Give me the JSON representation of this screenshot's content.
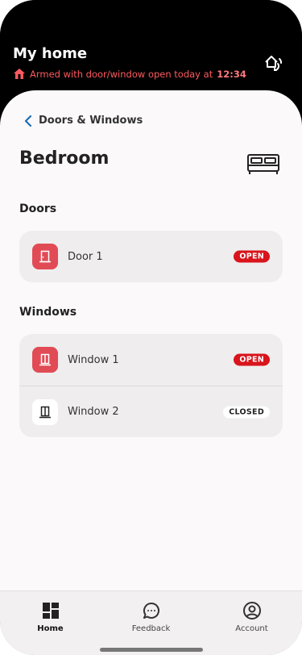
{
  "header": {
    "title": "My home",
    "status_text": "Armed with door/window open today at",
    "status_time": "12:34",
    "status_icon": "alarm-house-icon",
    "switch_icon": "switch-home-icon"
  },
  "nav": {
    "back_label": "Doors & Windows",
    "back_icon": "chevron-left-icon"
  },
  "room": {
    "title": "Bedroom",
    "icon": "bed-icon"
  },
  "doors": {
    "section_label": "Doors",
    "items": [
      {
        "label": "Door 1",
        "status": "OPEN",
        "icon": "door-icon"
      }
    ]
  },
  "windows": {
    "section_label": "Windows",
    "items": [
      {
        "label": "Window 1",
        "status": "OPEN",
        "icon": "window-icon"
      },
      {
        "label": "Window 2",
        "status": "CLOSED",
        "icon": "window-icon"
      }
    ]
  },
  "tabbar": {
    "items": [
      {
        "label": "Home",
        "icon": "home-grid-icon",
        "active": true
      },
      {
        "label": "Feedback",
        "icon": "feedback-icon",
        "active": false
      },
      {
        "label": "Account",
        "icon": "account-icon",
        "active": false
      }
    ]
  },
  "colors": {
    "accent_red": "#d9141c",
    "tile_red": "#e14b55",
    "header_bg": "#000000",
    "status_text": "#ff5a5f",
    "back_chevron": "#1f6fb2"
  }
}
